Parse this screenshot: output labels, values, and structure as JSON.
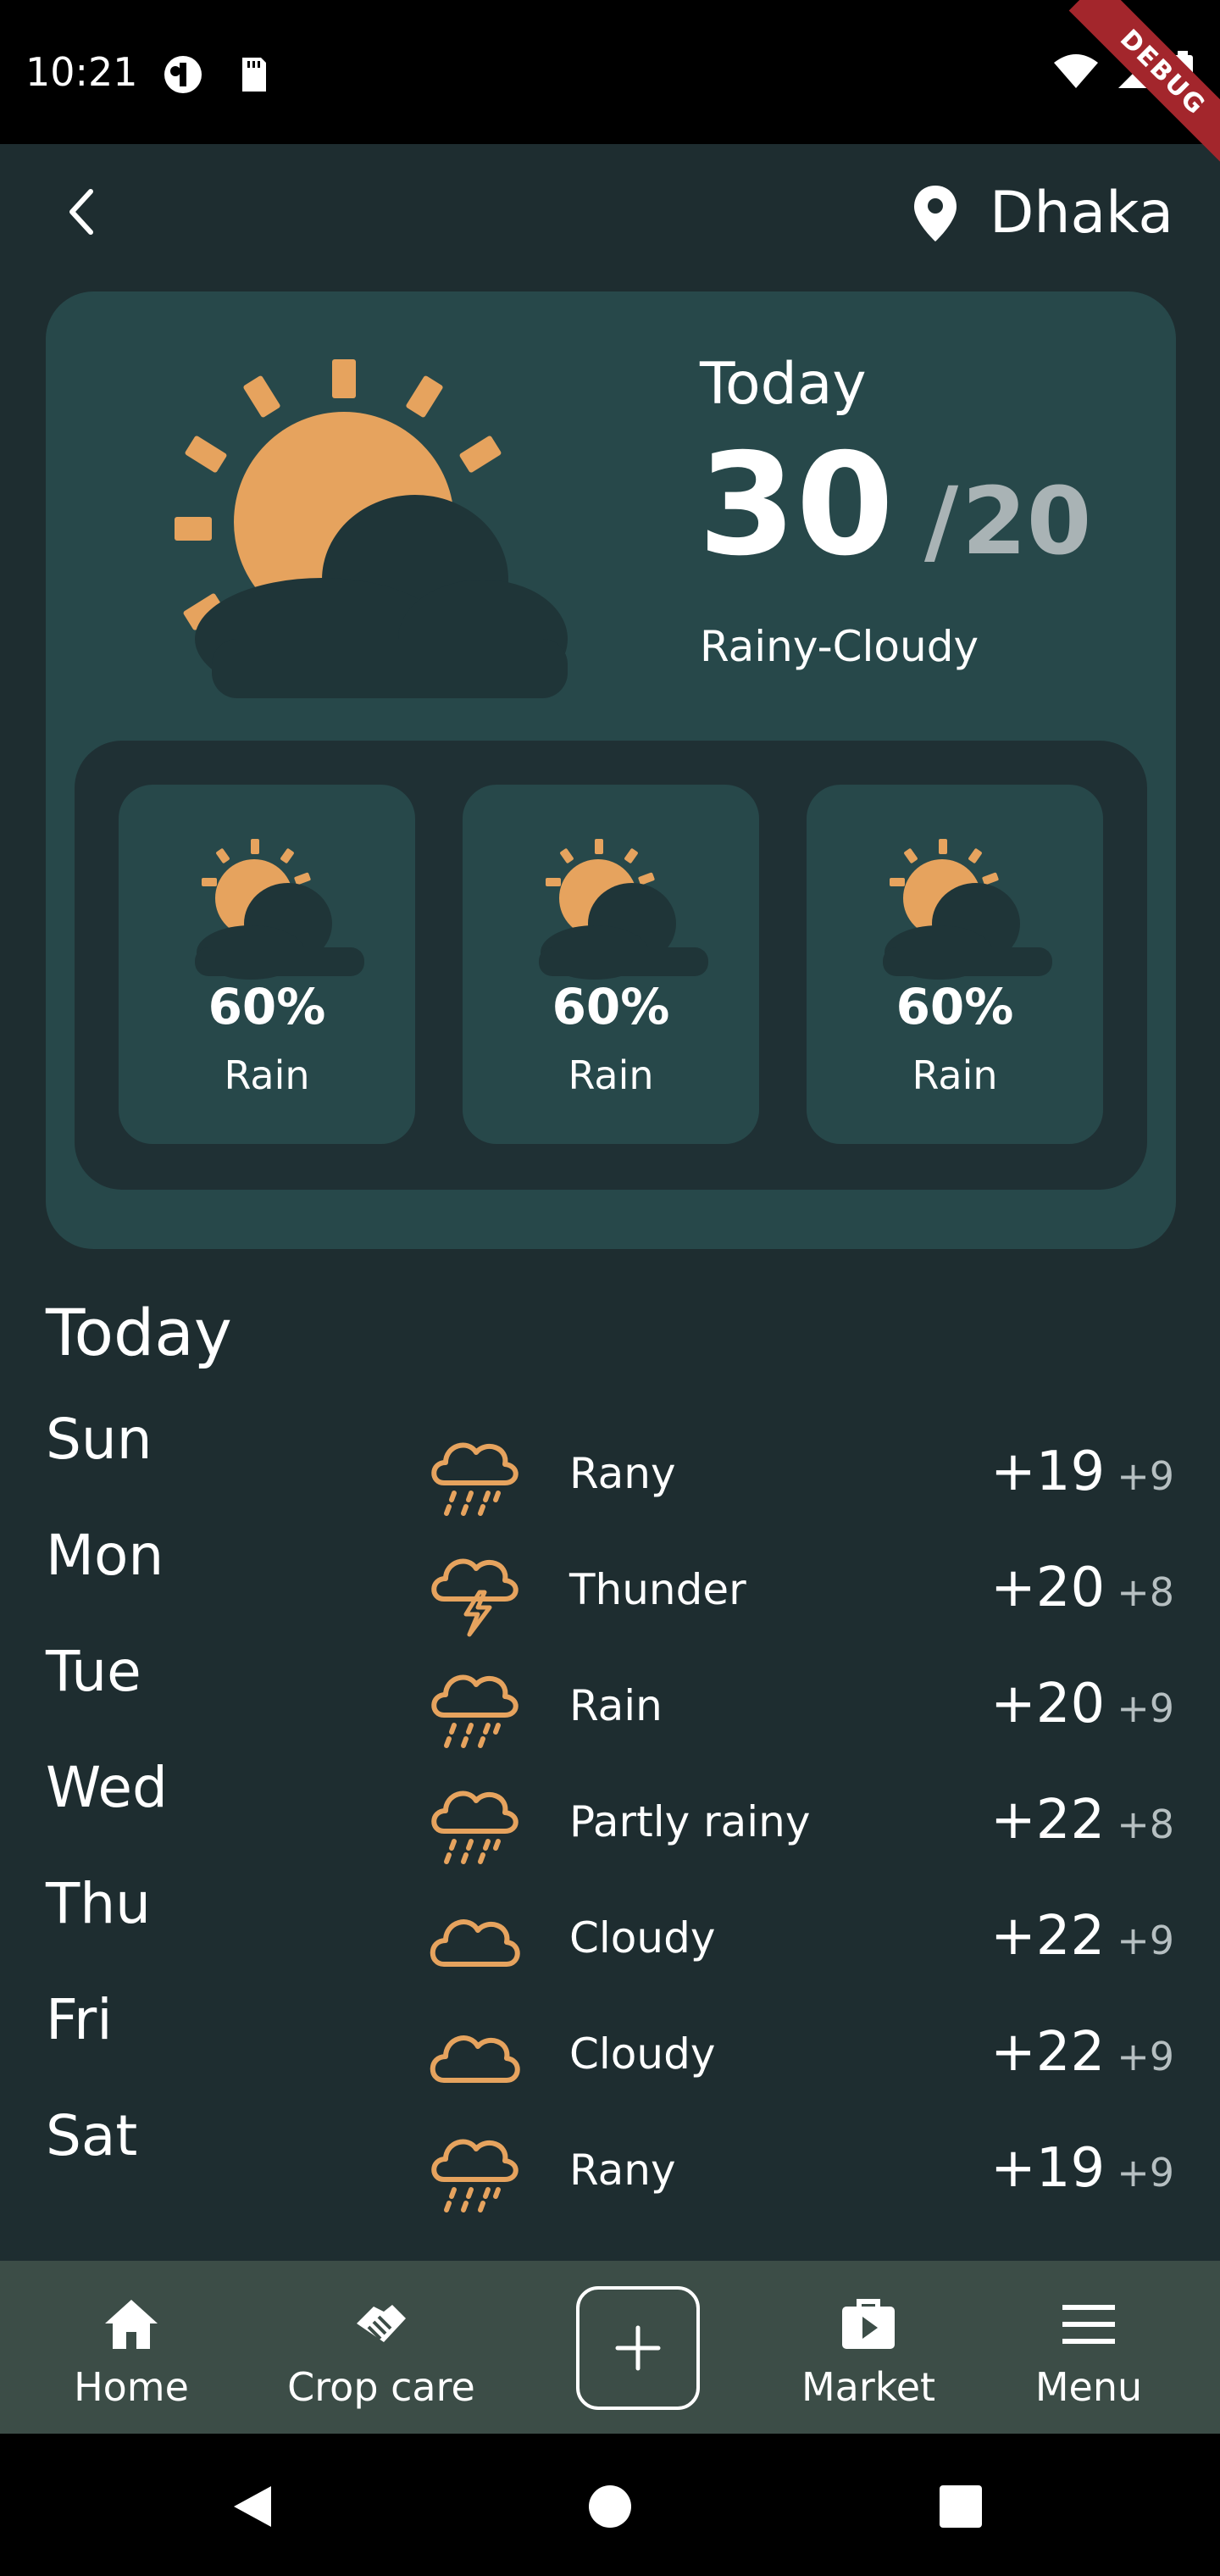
{
  "status_bar": {
    "time": "10:21",
    "debug_label": "DEBUG"
  },
  "header": {
    "location": "Dhaka"
  },
  "today": {
    "label": "Today",
    "high": "30",
    "low": "20",
    "condition": "Rainy-Cloudy"
  },
  "hourly": [
    {
      "percent": "60%",
      "label": "Rain"
    },
    {
      "percent": "60%",
      "label": "Rain"
    },
    {
      "percent": "60%",
      "label": "Rain"
    }
  ],
  "forecast": {
    "title": "Today",
    "days": [
      {
        "day": "Sun",
        "icon": "rain-cloud-icon",
        "condition": "Rany",
        "high": "+19",
        "low": "+9"
      },
      {
        "day": "Mon",
        "icon": "thunder-cloud-icon",
        "condition": "Thunder",
        "high": "+20",
        "low": "+8"
      },
      {
        "day": "Tue",
        "icon": "rain-cloud-icon",
        "condition": "Rain",
        "high": "+20",
        "low": "+9"
      },
      {
        "day": "Wed",
        "icon": "rain-cloud-icon",
        "condition": "Partly rainy",
        "high": "+22",
        "low": "+8"
      },
      {
        "day": "Thu",
        "icon": "cloud-icon",
        "condition": "Cloudy",
        "high": "+22",
        "low": "+9"
      },
      {
        "day": "Fri",
        "icon": "cloud-icon",
        "condition": "Cloudy",
        "high": "+22",
        "low": "+9"
      },
      {
        "day": "Sat",
        "icon": "rain-cloud-icon",
        "condition": "Rany",
        "high": "+19",
        "low": "+9"
      }
    ]
  },
  "bottom_nav": {
    "home": "Home",
    "crop_care": "Crop care",
    "market": "Market",
    "menu": "Menu"
  },
  "colors": {
    "background": "#1e2d30",
    "card": "#27484a",
    "panel": "#1f3034",
    "accent": "#e6a35e",
    "nav_bar": "#3c4d47"
  }
}
